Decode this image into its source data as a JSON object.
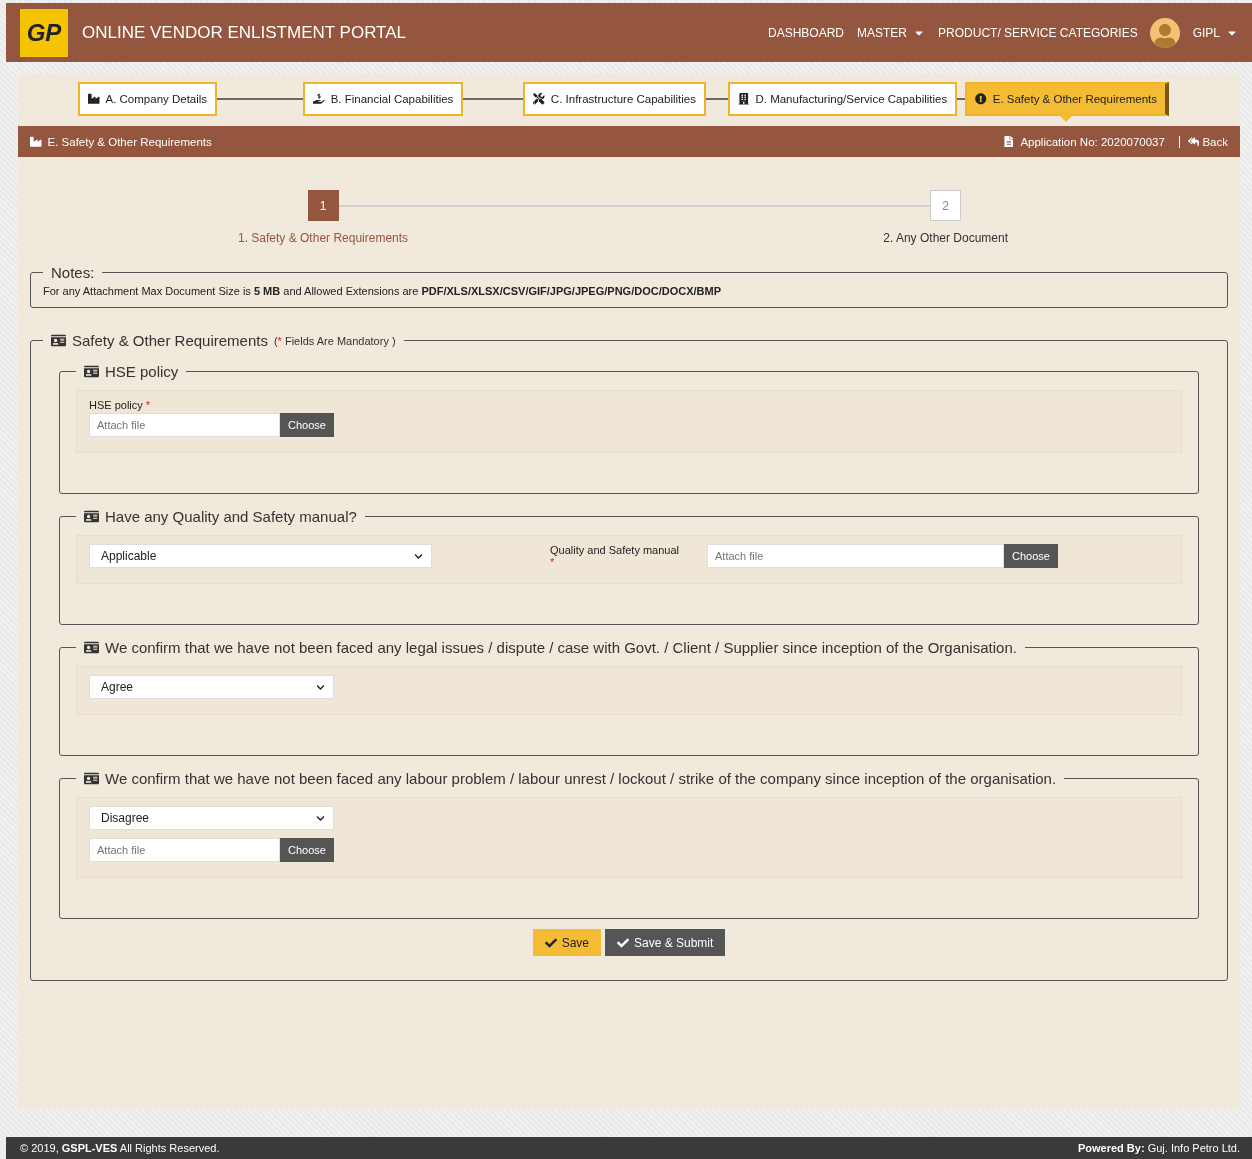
{
  "header": {
    "logo": "GP",
    "title": "ONLINE VENDOR ENLISTMENT PORTAL",
    "nav": [
      {
        "label": "DASHBOARD",
        "dropdown": false
      },
      {
        "label": "MASTER",
        "dropdown": true
      },
      {
        "label": "PRODUCT/ SERVICE CATEGORIES",
        "dropdown": false
      }
    ],
    "user": {
      "name": "GIPL",
      "dropdown": true
    }
  },
  "wizard_tabs": [
    {
      "kind": "company",
      "label": "A. Company Details",
      "selected": false
    },
    {
      "kind": "financial",
      "label": "B. Financial Capabilities",
      "selected": false
    },
    {
      "kind": "infrastructure",
      "label": "C. Infrastructure Capabilities",
      "selected": false
    },
    {
      "kind": "manufacturing",
      "label": "D. Manufacturing/Service Capabilities",
      "selected": false
    },
    {
      "kind": "safety",
      "label": "E. Safety & Other Requirements",
      "selected": true
    }
  ],
  "section_bar": {
    "title": "E. Safety & Other Requirements",
    "application_no": "Application No: 2020070037",
    "back": "Back"
  },
  "steps": [
    {
      "number": "1",
      "label": "1. Safety & Other Requirements",
      "selected": true
    },
    {
      "number": "2",
      "label": "2. Any Other Document",
      "selected": false
    }
  ],
  "notes": {
    "legend": "Notes:",
    "text": "For any Attachment Max Document Size is **5 MB** and Allowed Extensions are **PDF/XLS/XLSX/CSV/GIF/JPG/JPEG/PNG/DOC/DOCX/BMP**"
  },
  "form": {
    "legend": "Safety & Other Requirements",
    "note_open": "(",
    "note_mark": "*",
    "note_text": "Fields Are Mandatory )"
  },
  "groups": [
    {
      "legend": "HSE policy",
      "inline": false,
      "fields": [
        {
          "kind": "file",
          "label": "HSE policy",
          "required": true,
          "placeholder": "Attach file",
          "button": "Choose"
        }
      ]
    },
    {
      "legend": "Have any Quality and Safety manual?",
      "inline": true,
      "fields": [
        {
          "kind": "select",
          "value": "Applicable"
        },
        {
          "kind": "file",
          "label": "Quality and Safety manual",
          "required": true,
          "placeholder": "Attach file",
          "button": "Choose"
        }
      ]
    },
    {
      "legend": "We confirm that we have not been faced any legal issues / dispute / case with Govt. / Client / Supplier since inception of the Organisation.",
      "inline": false,
      "fields": [
        {
          "kind": "select",
          "value": "Agree"
        }
      ]
    },
    {
      "legend": "We confirm that we have not been faced any labour problem / labour unrest / lockout / strike of the company since inception of the organisation.",
      "inline": false,
      "fields": [
        {
          "kind": "select",
          "value": "Disagree"
        },
        {
          "kind": "file",
          "placeholder": "Attach file",
          "button": "Choose"
        }
      ]
    }
  ],
  "buttons": [
    {
      "kind": "primary",
      "label": "Save"
    },
    {
      "kind": "secondary",
      "label": "Save & Submit"
    }
  ],
  "footer": {
    "left": "© 2019, **GSPL-VES** All Rights Reserved.",
    "right": "**Powered By:** Guj. Info Petro Ltd."
  }
}
